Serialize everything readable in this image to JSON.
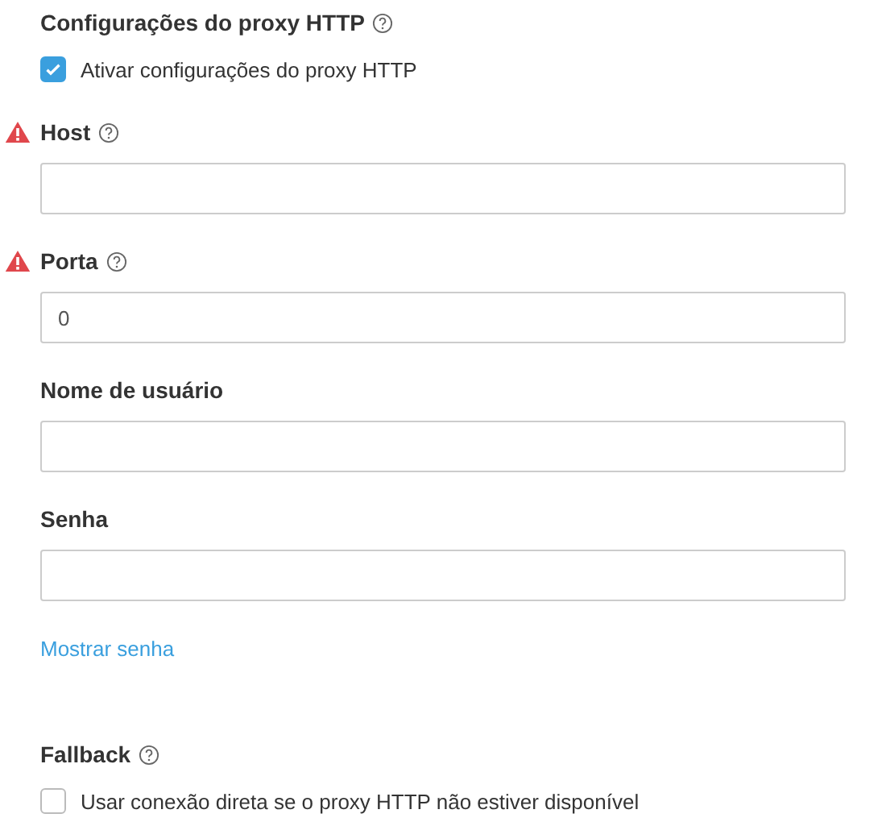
{
  "proxy_section": {
    "title": "Configurações do proxy HTTP",
    "help": true,
    "enable": {
      "label": "Ativar configurações do proxy HTTP",
      "checked": true
    }
  },
  "fields": [
    {
      "label": "Host",
      "warning": true,
      "help": true
    },
    {
      "label": "Porta",
      "warning": true,
      "help": true,
      "value": "0"
    },
    {
      "label": "Nome de usuário",
      "warning": false,
      "help": false
    },
    {
      "label": "Senha",
      "warning": false,
      "help": false
    }
  ],
  "show_password_link": "Mostrar senha",
  "fallback_section": {
    "title": "Fallback",
    "help": true,
    "option": {
      "label": "Usar conexão direta se o proxy HTTP não estiver disponível",
      "checked": false
    }
  }
}
